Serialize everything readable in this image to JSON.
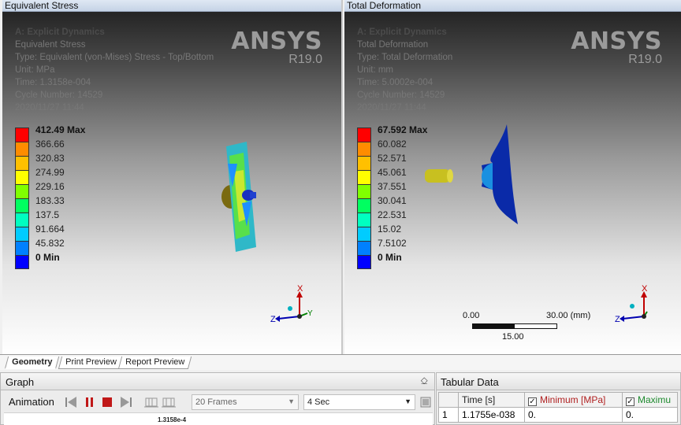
{
  "left_viewport": {
    "title": "Equivalent Stress",
    "info": [
      "A: Explicit Dynamics",
      "Equivalent Stress",
      "Type: Equivalent (von-Mises) Stress - Top/Bottom",
      "Unit: MPa",
      "Time: 1.3158e-004",
      "Cycle Number: 14529",
      "2020/11/27 11:44"
    ],
    "brand": "ANSYS",
    "version": "R19.0",
    "legend_labels": [
      "412.49 Max",
      "366.66",
      "320.83",
      "274.99",
      "229.16",
      "183.33",
      "137.5",
      "91.664",
      "45.832",
      "0 Min"
    ],
    "triad": {
      "x": "X",
      "y": "Y",
      "z": "Z"
    }
  },
  "right_viewport": {
    "title": "Total Deformation",
    "info": [
      "A: Explicit Dynamics",
      "Total Deformation",
      "Type: Total Deformation",
      "Unit: mm",
      "Time: 5.0002e-004",
      "Cycle Number: 14529",
      "2020/11/27 11:44"
    ],
    "brand": "ANSYS",
    "version": "R19.0",
    "legend_labels": [
      "67.592 Max",
      "60.082",
      "52.571",
      "45.061",
      "37.551",
      "30.041",
      "22.531",
      "15.02",
      "7.5102",
      "0 Min"
    ],
    "scale": {
      "start": "0.00",
      "end": "30.00 (mm)",
      "mid": "15.00"
    },
    "triad": {
      "x": "X",
      "y": "Y",
      "z": "Z"
    }
  },
  "legend_colors": [
    "#ff0000",
    "#ff8c00",
    "#ffc000",
    "#ffff00",
    "#80ff00",
    "#00ff60",
    "#00ffc0",
    "#00ccff",
    "#0080ff",
    "#0000ff"
  ],
  "tabs": [
    "Geometry",
    "Print Preview",
    "Report Preview"
  ],
  "graph": {
    "title": "Graph",
    "pin": "⎐",
    "animation_label": "Animation",
    "frames": "20 Frames",
    "duration": "4 Sec",
    "time_tick": "1.3158e-4"
  },
  "tabular": {
    "title": "Tabular Data",
    "headers": [
      "Time [s]",
      "Minimum [MPa]",
      "Maximu"
    ],
    "rows": [
      {
        "index": "1",
        "time": "1.1755e-038",
        "min": "0.",
        "max": "0."
      }
    ]
  }
}
